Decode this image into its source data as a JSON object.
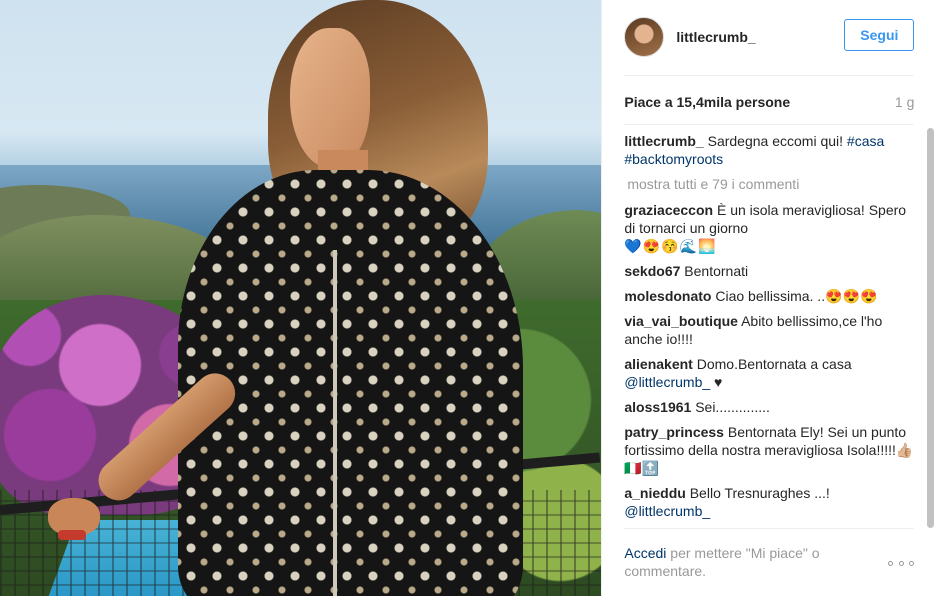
{
  "post": {
    "username": "littlecrumb_",
    "follow_label": "Segui",
    "likes": "Piace a 15,4mila persone",
    "time": "1 g"
  },
  "caption": {
    "author": "littlecrumb_",
    "text": " Sardegna eccomi qui! ",
    "tag1": "#casa",
    "tag2": "#backtomyroots"
  },
  "show_all": "mostra tutti e 79 i commenti",
  "comments": [
    {
      "author": "graziaceccon",
      "text": " È un isola meravigliosa! Spero di tornarci un giorno",
      "extra": "💙😍😚🌊🌅"
    },
    {
      "author": "sekdo67",
      "text": " Bentornati"
    },
    {
      "author": "molesdonato",
      "text": " Ciao bellissima. ..😍😍😍"
    },
    {
      "author": "via_vai_boutique",
      "text": " Abito bellissimo,ce l'ho anche io!!!!"
    },
    {
      "author": "alienakent",
      "text": " Domo.Bentornata a casa ",
      "mention": "@littlecrumb_",
      "after": " ♥"
    },
    {
      "author": "aloss1961",
      "text": " Sei.............."
    },
    {
      "author": "patry_princess",
      "text": " Bentornata Ely! Sei un punto fortissimo della nostra meravigliosa Isola!!!!!👍🏼🇮🇹🔝"
    },
    {
      "author": "a_nieddu",
      "text": " Bello Tresnuraghes ...! ",
      "mention": "@littlecrumb_"
    }
  ],
  "footer": {
    "login": "Accedi",
    "rest": " per mettere \"Mi piace\" o commentare."
  },
  "icons": {
    "more": "more-options-icon"
  },
  "colors": {
    "accent": "#3897f0",
    "link": "#003569",
    "muted": "#999999"
  }
}
